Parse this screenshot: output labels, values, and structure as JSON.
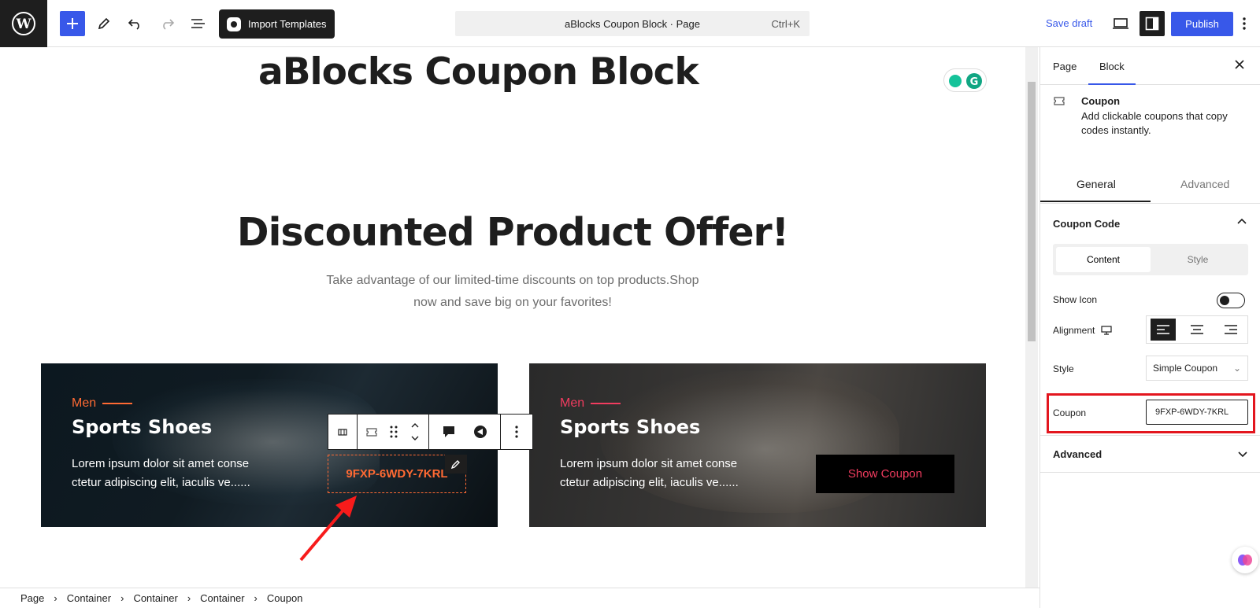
{
  "toolbar": {
    "import_label": "Import Templates",
    "document_title": "aBlocks Coupon Block · Page",
    "shortcut": "Ctrl+K",
    "save_draft": "Save draft",
    "publish": "Publish",
    "accent_color": "#3858e9"
  },
  "canvas": {
    "page_title": "aBlocks Coupon Block",
    "headline": "Discounted Product Offer!",
    "subtitle": "Take advantage of our limited-time discounts on top products.Shop now and save big on your favorites!",
    "cards": [
      {
        "category": "Men",
        "title": "Sports Shoes",
        "text": "Lorem ipsum dolor sit amet conse ctetur adipiscing elit, iaculis ve......",
        "coupon_code": "9FXP-6WDY-7KRL",
        "accent_color": "#ff6a33"
      },
      {
        "category": "Men",
        "title": "Sports Shoes",
        "text": "Lorem ipsum dolor sit amet conse ctetur adipiscing elit, iaculis ve......",
        "button_label": "Show Coupon",
        "accent_color": "#f13c5f"
      }
    ]
  },
  "breadcrumb": [
    "Page",
    "Container",
    "Container",
    "Container",
    "Coupon"
  ],
  "sidebar": {
    "tabs": [
      "Page",
      "Block"
    ],
    "active_tab": "Block",
    "block_name": "Coupon",
    "block_description": "Add clickable coupons that copy codes instantly.",
    "inner_tabs": [
      "General",
      "Advanced"
    ],
    "panel_title": "Coupon Code",
    "segment": [
      "Content",
      "Style"
    ],
    "show_icon_label": "Show Icon",
    "show_icon_on": false,
    "alignment_label": "Alignment",
    "alignment_value": "left",
    "style_label": "Style",
    "style_value": "Simple Coupon",
    "coupon_label": "Coupon",
    "coupon_value": "9FXP-6WDY-7KRL",
    "advanced_title": "Advanced"
  }
}
